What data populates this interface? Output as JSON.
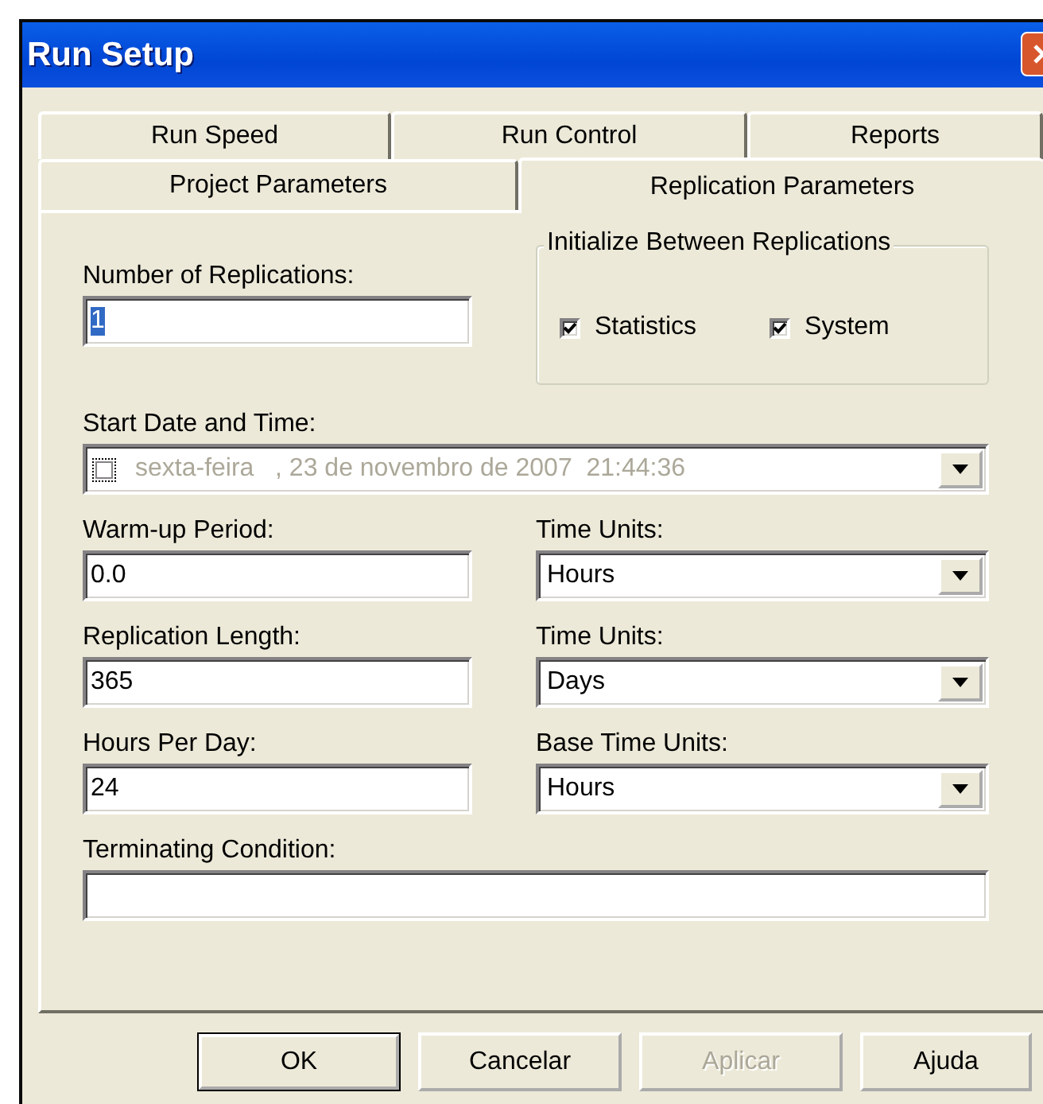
{
  "window": {
    "title": "Run Setup"
  },
  "tab_rows": [
    [
      {
        "label": "Run Speed",
        "selected": false
      },
      {
        "label": "Run Control",
        "selected": false
      },
      {
        "label": "Reports",
        "selected": false
      }
    ],
    [
      {
        "label": "Project Parameters",
        "selected": false
      },
      {
        "label": "Replication Parameters",
        "selected": true
      }
    ]
  ],
  "replications": {
    "label": "Number of Replications:",
    "value": "1",
    "highlighted": true
  },
  "initialize": {
    "title": "Initialize Between Replications",
    "options": [
      {
        "label": "Statistics",
        "checked": true
      },
      {
        "label": "System",
        "checked": true
      }
    ]
  },
  "start_date": {
    "label": "Start Date and Time:",
    "value": "sexta-feira   , 23 de novembro de 2007  21:44:36",
    "checked": false,
    "disabled": true
  },
  "rows": [
    {
      "field": {
        "label": "Warm-up Period:",
        "value": "0.0"
      },
      "units": {
        "label": "Time Units:",
        "value": "Hours"
      }
    },
    {
      "field": {
        "label": "Replication Length:",
        "value": "365"
      },
      "units": {
        "label": "Time Units:",
        "value": "Days"
      }
    },
    {
      "field": {
        "label": "Hours Per Day:",
        "value": "24"
      },
      "units": {
        "label": "Base Time Units:",
        "value": "Hours"
      }
    }
  ],
  "terminating": {
    "label": "Terminating Condition:"
  },
  "buttons": [
    {
      "label": "OK",
      "default": true,
      "disabled": false
    },
    {
      "label": "Cancelar",
      "default": false,
      "disabled": false
    },
    {
      "label": "Aplicar",
      "default": false,
      "disabled": true
    },
    {
      "label": "Ajuda",
      "default": false,
      "disabled": false
    }
  ]
}
